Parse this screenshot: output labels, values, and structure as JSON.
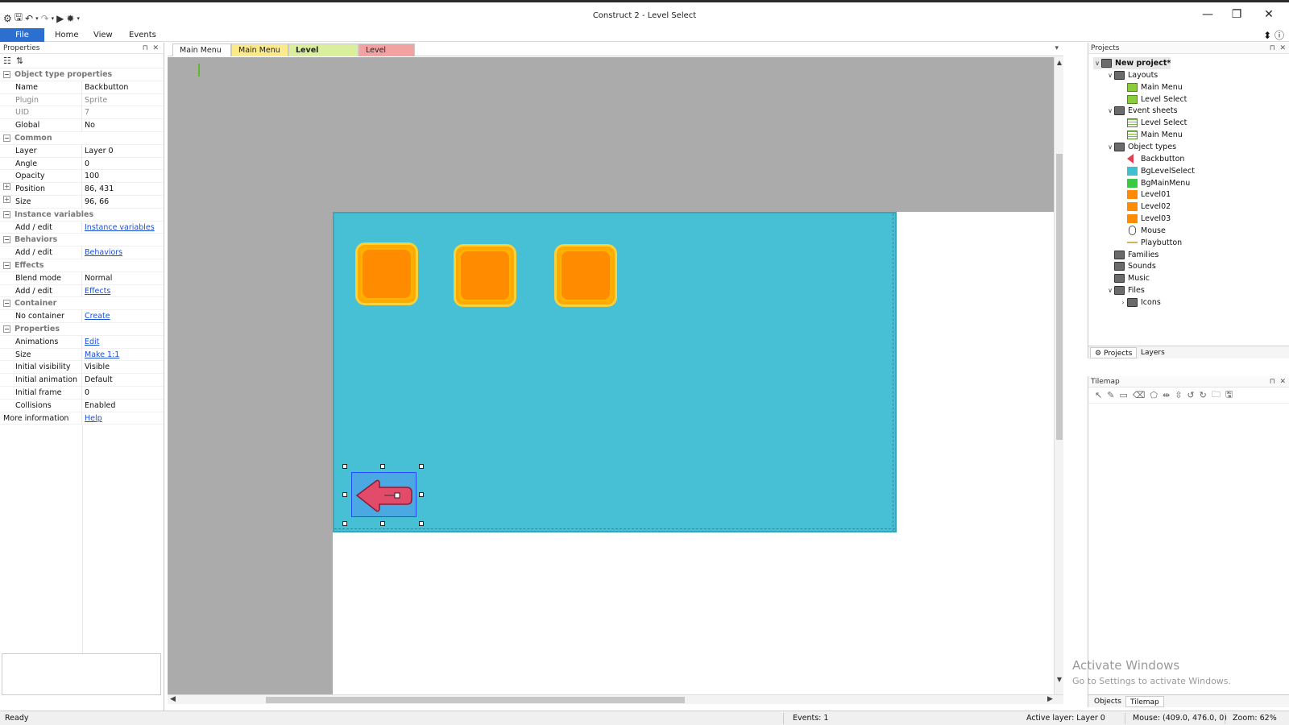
{
  "window": {
    "title": "Construct 2 - Level Select",
    "minimize_icon": "—",
    "restore_icon": "❐",
    "close_icon": "✕"
  },
  "ribbon": {
    "tabs": [
      "File",
      "Home",
      "View",
      "Events"
    ]
  },
  "properties": {
    "header": "Properties",
    "rows": [
      {
        "type": "cat",
        "label": "Object type properties"
      },
      {
        "label": "Name",
        "value": "Backbutton"
      },
      {
        "label": "Plugin",
        "value": "Sprite",
        "gray": true
      },
      {
        "label": "UID",
        "value": "7",
        "gray": true
      },
      {
        "label": "Global",
        "value": "No"
      },
      {
        "type": "cat",
        "label": "Common"
      },
      {
        "label": "Layer",
        "value": "Layer 0"
      },
      {
        "label": "Angle",
        "value": "0"
      },
      {
        "label": "Opacity",
        "value": "100"
      },
      {
        "label": "Position",
        "value": "86, 431",
        "expand": true
      },
      {
        "label": "Size",
        "value": "96, 66",
        "expand": true
      },
      {
        "type": "cat",
        "label": "Instance variables"
      },
      {
        "label": "Add / edit",
        "value": "Instance variables",
        "link": true
      },
      {
        "type": "cat",
        "label": "Behaviors"
      },
      {
        "label": "Add / edit",
        "value": "Behaviors",
        "link": true
      },
      {
        "type": "cat",
        "label": "Effects"
      },
      {
        "label": "Blend mode",
        "value": "Normal"
      },
      {
        "label": "Add / edit",
        "value": "Effects",
        "link": true
      },
      {
        "type": "cat",
        "label": "Container"
      },
      {
        "label": "No container",
        "value": "Create",
        "link": true
      },
      {
        "type": "cat",
        "label": "Properties"
      },
      {
        "label": "Animations",
        "value": "Edit",
        "link": true
      },
      {
        "label": "Size",
        "value": "Make 1:1",
        "link": true
      },
      {
        "label": "Initial visibility",
        "value": "Visible"
      },
      {
        "label": "Initial animation",
        "value": "Default"
      },
      {
        "label": "Initial frame",
        "value": "0"
      },
      {
        "label": "Collisions",
        "value": "Enabled"
      },
      {
        "label": "More information",
        "value": "Help",
        "link": true,
        "noindent": true
      }
    ]
  },
  "doc_tabs": [
    {
      "label": "Main Menu",
      "color": "#ffffff"
    },
    {
      "label": "Main Menu",
      "color": "#fbe98a"
    },
    {
      "label": "Level Select",
      "color": "#d9ef9c",
      "active": true,
      "close": "✕"
    },
    {
      "label": "Level Select",
      "color": "#f3a2a2"
    }
  ],
  "projects": {
    "header": "Projects",
    "tree": [
      {
        "label": "New project*",
        "level": 0,
        "icon": "folder",
        "twisty": "∨",
        "bold": true
      },
      {
        "label": "Layouts",
        "level": 1,
        "icon": "folder",
        "twisty": "∨"
      },
      {
        "label": "Main Menu",
        "level": 2,
        "icon": "layout"
      },
      {
        "label": "Level Select",
        "level": 2,
        "icon": "layout"
      },
      {
        "label": "Event sheets",
        "level": 1,
        "icon": "folder",
        "twisty": "∨"
      },
      {
        "label": "Level Select",
        "level": 2,
        "icon": "sheet"
      },
      {
        "label": "Main Menu",
        "level": 2,
        "icon": "sheet"
      },
      {
        "label": "Object types",
        "level": 1,
        "icon": "folder",
        "twisty": "∨"
      },
      {
        "label": "Backbutton",
        "level": 2,
        "icon": "arrow"
      },
      {
        "label": "BgLevelSelect",
        "level": 2,
        "icon": "teal"
      },
      {
        "label": "BgMainMenu",
        "level": 2,
        "icon": "green"
      },
      {
        "label": "Level01",
        "level": 2,
        "icon": "orange"
      },
      {
        "label": "Level02",
        "level": 2,
        "icon": "orange"
      },
      {
        "label": "Level03",
        "level": 2,
        "icon": "orange"
      },
      {
        "label": "Mouse",
        "level": 2,
        "icon": "mouse"
      },
      {
        "label": "Playbutton",
        "level": 2,
        "icon": "line"
      },
      {
        "label": "Families",
        "level": 1,
        "icon": "folder"
      },
      {
        "label": "Sounds",
        "level": 1,
        "icon": "folder"
      },
      {
        "label": "Music",
        "level": 1,
        "icon": "folder"
      },
      {
        "label": "Files",
        "level": 1,
        "icon": "folder",
        "twisty": "∨"
      },
      {
        "label": "Icons",
        "level": 2,
        "icon": "folder",
        "twisty": "›"
      }
    ],
    "bottom_tabs": [
      "Projects",
      "Layers"
    ]
  },
  "tilemap": {
    "header": "Tilemap",
    "watermark_title": "Activate Windows",
    "watermark_sub": "Go to Settings to activate Windows."
  },
  "bottom_tabs": [
    "Objects",
    "Tilemap"
  ],
  "status": {
    "ready": "Ready",
    "events": "Events: 1",
    "active_layer": "Active layer: Layer 0",
    "mouse": "Mouse: (409.0, 476.0, 0)",
    "zoom": "Zoom: 62%"
  }
}
